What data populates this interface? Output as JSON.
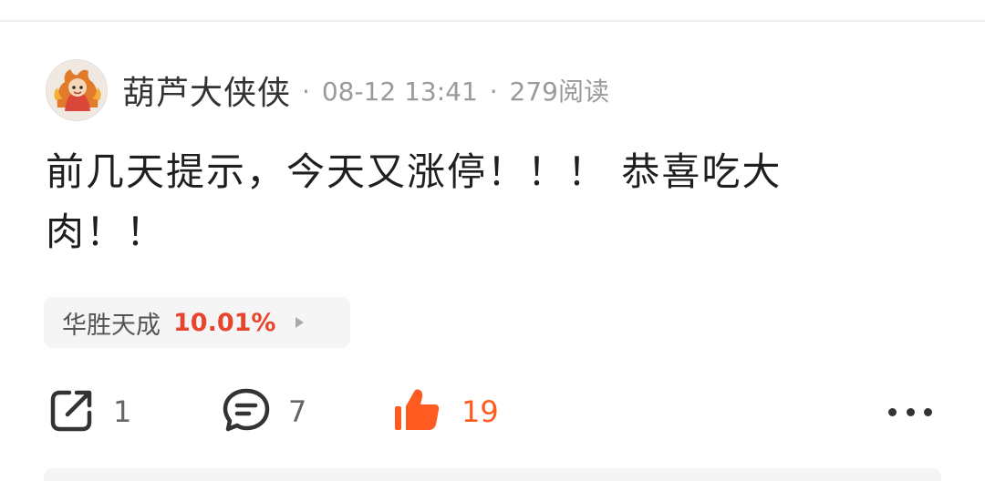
{
  "post": {
    "author": "葫芦大侠侠",
    "separator": "·",
    "timestamp": "08-12 13:41",
    "reads": "279阅读",
    "text_line1": "前几天提示，今天又涨停！！！ 恭喜吃大",
    "text_line2": "肉！！"
  },
  "stock": {
    "name": "华胜天成",
    "change": "10.01%",
    "change_color": "#e8452f"
  },
  "actions": {
    "share_count": "1",
    "comment_count": "7",
    "like_count": "19",
    "like_color": "#ff5a1f",
    "icons": [
      "share-icon",
      "comment-icon",
      "thumbs-up-icon",
      "more-icon"
    ]
  }
}
